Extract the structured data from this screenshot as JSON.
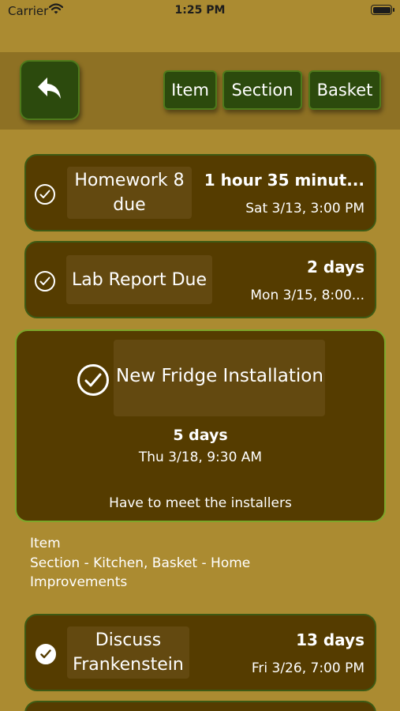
{
  "status_bar": {
    "carrier": "Carrier",
    "time": "1:25 PM"
  },
  "toolbar": {
    "back_icon": "reply-arrow-icon",
    "tabs": [
      {
        "label": "Item"
      },
      {
        "label": "Section"
      },
      {
        "label": "Basket"
      }
    ]
  },
  "items": [
    {
      "title": "Homework 8 due",
      "due_relative": "1 hour 35 minut...",
      "due_date": "Sat 3/13, 3:00 PM",
      "checked": false
    },
    {
      "title": "Lab Report Due",
      "due_relative": "2 days",
      "due_date": "Mon 3/15, 8:00...",
      "checked": false
    },
    {
      "title": "New Fridge Installation",
      "due_relative": "5 days",
      "due_date": "Thu 3/18, 9:30 AM",
      "note": "Have to meet the installers",
      "checked": false,
      "expanded": true
    },
    {
      "title": "Discuss Frankenstein",
      "due_relative": "13 days",
      "due_date": "Fri 3/26, 7:00 PM",
      "checked": true
    }
  ],
  "selected_info": {
    "kind": "Item",
    "location_line1": "Section - Kitchen, Basket - Home",
    "location_line2": "Improvements"
  },
  "colors": {
    "background": "#ab8b31",
    "toolbar": "#8e7124",
    "card": "#553c00",
    "button": "#2c4a0d"
  }
}
